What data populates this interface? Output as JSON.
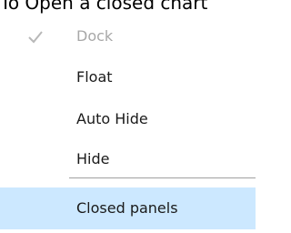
{
  "heading": {
    "text": "To Open a closed chart"
  },
  "menu": {
    "items": [
      {
        "label": "Dock",
        "state": "disabled",
        "checked": true,
        "check_icon": "checkmark-icon"
      },
      {
        "label": "Float",
        "state": "enabled",
        "checked": false
      },
      {
        "label": "Auto Hide",
        "state": "enabled",
        "checked": false
      },
      {
        "label": "Hide",
        "state": "enabled",
        "checked": false
      },
      {
        "label": "Closed panels",
        "state": "highlighted",
        "checked": false
      }
    ]
  },
  "colors": {
    "highlight": "#cce8ff",
    "disabled_text": "#a8a8a8",
    "checkmark": "#b8b8b8",
    "separator": "#a0a0a0"
  }
}
